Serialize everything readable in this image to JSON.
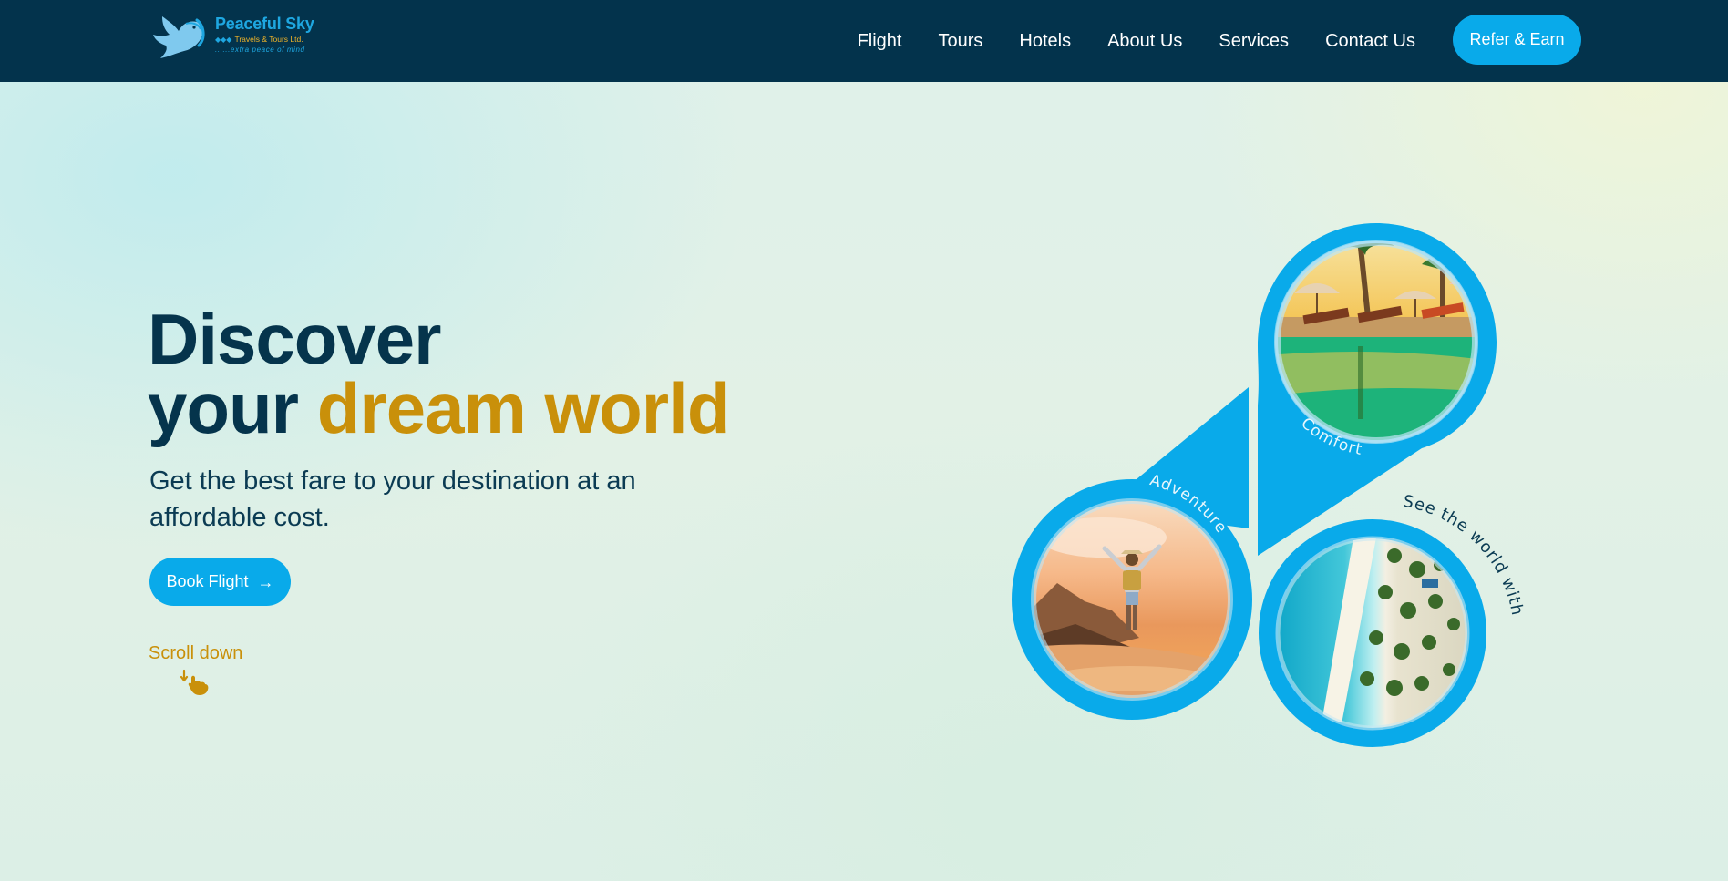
{
  "brand": {
    "name": "Peaceful Sky",
    "subtitle": "Travels & Tours Ltd.",
    "diamonds": "◆◆◆",
    "tagline": "......extra peace of mind"
  },
  "nav": {
    "links": [
      "Flight",
      "Tours",
      "Hotels",
      "About Us",
      "Services",
      "Contact Us"
    ],
    "cta": "Refer & Earn"
  },
  "hero": {
    "title_line1": "Discover",
    "title_line2_plain": "your ",
    "title_line2_accent": "dream world",
    "subtitle": "Get the best fare to your destination at an affordable cost.",
    "button_label": "Book Flight",
    "scroll_label": "Scroll down"
  },
  "collage": {
    "label_comfort": "Comfort",
    "label_adventures": "Adventures",
    "label_world": "See the world with us"
  },
  "colors": {
    "navy": "#03334c",
    "accent_blue": "#09aaea",
    "gold": "#c9900a"
  }
}
